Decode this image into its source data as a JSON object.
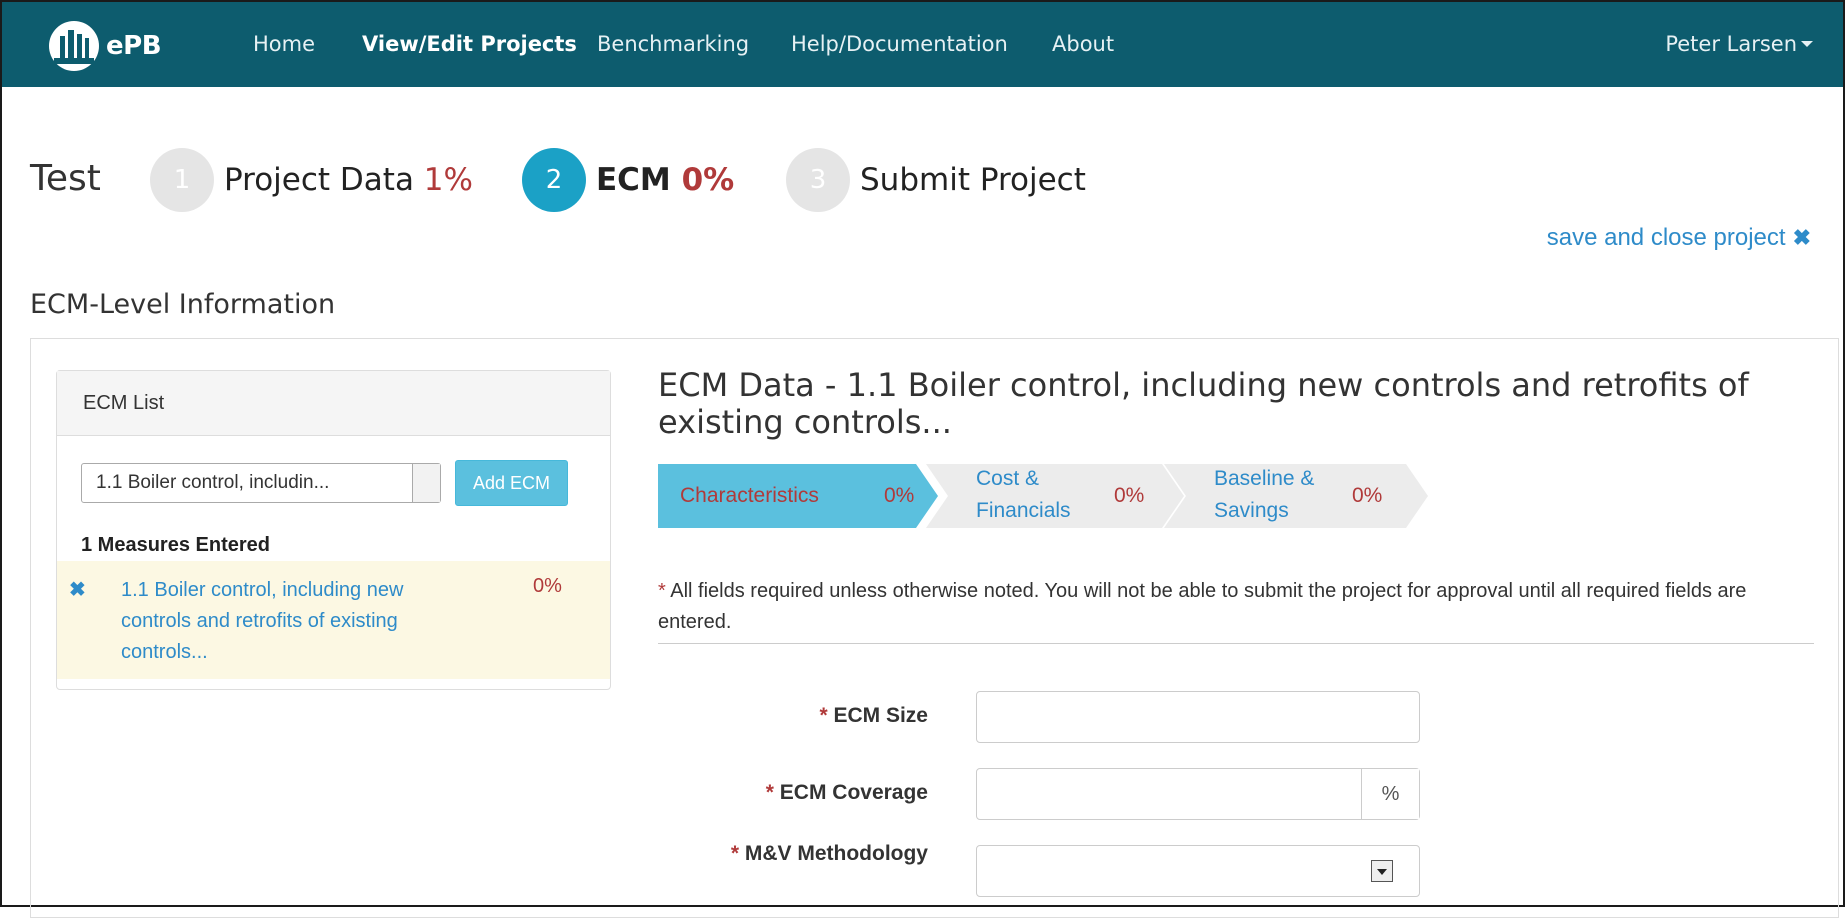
{
  "nav": {
    "brand": "ePB",
    "links": [
      "Home",
      "View/Edit Projects",
      "Benchmarking",
      "Help/Documentation",
      "About"
    ],
    "user": "Peter Larsen"
  },
  "project": {
    "name": "Test",
    "steps": [
      {
        "number": "1",
        "label": "Project Data",
        "percent": "1%"
      },
      {
        "number": "2",
        "label": "ECM",
        "percent": "0%"
      },
      {
        "number": "3",
        "label": "Submit Project",
        "percent": ""
      }
    ]
  },
  "save_close_label": "save and close project",
  "section_title": "ECM-Level Information",
  "ecm_list": {
    "heading": "ECM List",
    "selected": "1.1 Boiler control, includin...",
    "add_button": "Add ECM",
    "count_label": "1 Measures Entered",
    "items": [
      {
        "name": "1.1 Boiler control, including new controls and retrofits of existing controls...",
        "percent": "0%"
      }
    ]
  },
  "ecm_data": {
    "title": "ECM Data - 1.1 Boiler control, including new controls and retrofits of existing controls...",
    "tabs": [
      {
        "label_line1": "Characteristics",
        "label_line2": "",
        "percent": "0%"
      },
      {
        "label_line1": "Cost &",
        "label_line2": "Financials",
        "percent": "0%"
      },
      {
        "label_line1": "Baseline &",
        "label_line2": "Savings",
        "percent": "0%"
      }
    ],
    "required_note_star": "*",
    "required_note": "All fields required unless otherwise noted. You will not be able to submit the project for approval until all required fields are entered.",
    "fields": [
      {
        "label": "ECM Size",
        "value": ""
      },
      {
        "label": "ECM Coverage",
        "value": "",
        "addon": "%"
      },
      {
        "label": "M&V Methodology",
        "value": ""
      }
    ]
  },
  "colors": {
    "navbar": "#0d5c6e",
    "active_step": "#1ba1c6",
    "active_tab": "#5bc0de",
    "link": "#2e8bc9",
    "percent_red": "#b03a3a",
    "selected_row": "#fcf8e3"
  }
}
